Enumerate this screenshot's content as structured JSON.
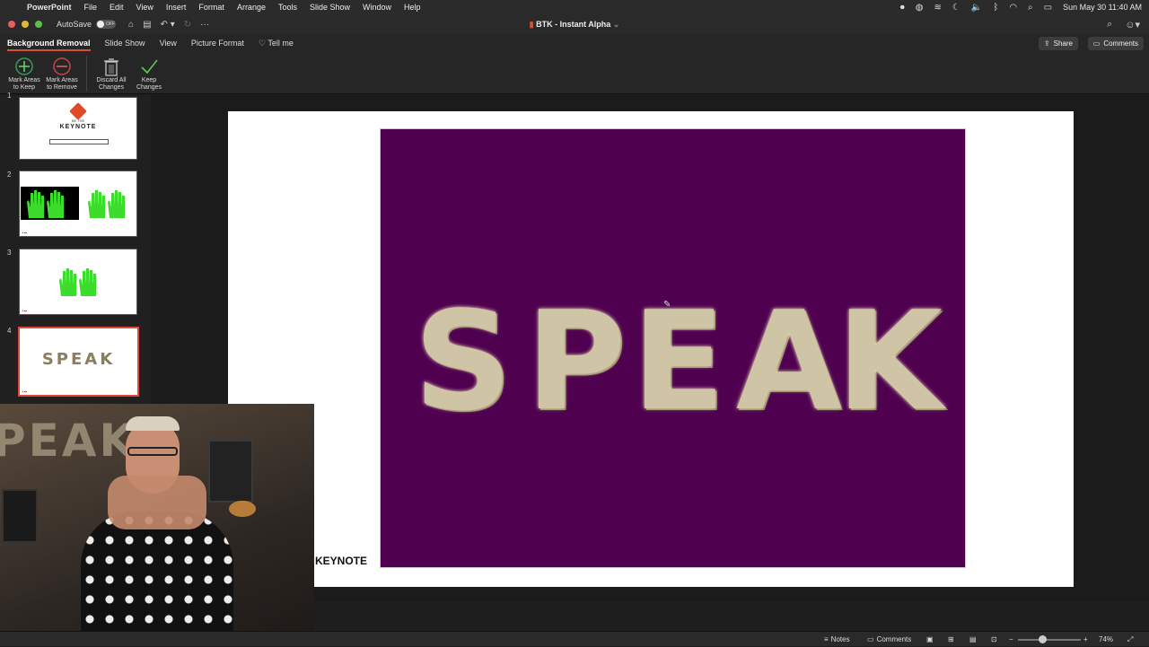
{
  "menubar": {
    "app_name": "PowerPoint",
    "items": [
      "File",
      "Edit",
      "View",
      "Insert",
      "Format",
      "Arrange",
      "Tools",
      "Slide Show",
      "Window",
      "Help"
    ],
    "clock": "Sun May 30  11:40 AM"
  },
  "titlebar": {
    "autosave_label": "AutoSave",
    "autosave_state": "OFF",
    "doc_title": "BTK - Instant Alpha"
  },
  "ribbon_tabs": [
    "Background Removal",
    "Slide Show",
    "View",
    "Picture Format"
  ],
  "tell_me": "Tell me",
  "share_label": "Share",
  "comments_label": "Comments",
  "ribbon": {
    "mark_keep": [
      "Mark Areas",
      "to Keep"
    ],
    "mark_remove": [
      "Mark Areas",
      "to Remove"
    ],
    "discard": [
      "Discard All",
      "Changes"
    ],
    "keep": [
      "Keep",
      "Changes"
    ]
  },
  "slides": [
    {
      "num": "1",
      "title": "KEYNOTE",
      "subtitle": "BE THE"
    },
    {
      "num": "2"
    },
    {
      "num": "3"
    },
    {
      "num": "4",
      "text": "SPEAK"
    }
  ],
  "slide": {
    "letters": [
      "S",
      "P",
      "E",
      "A",
      "K"
    ],
    "keynote_text": "KEYNOTE",
    "image_bg_color": "#4f0150"
  },
  "statusbar": {
    "notes": "Notes",
    "comments": "Comments",
    "zoom": "74%"
  },
  "colors": {
    "accent": "#d35230",
    "selection": "#e0473a",
    "hands": "#3bdc2c"
  }
}
